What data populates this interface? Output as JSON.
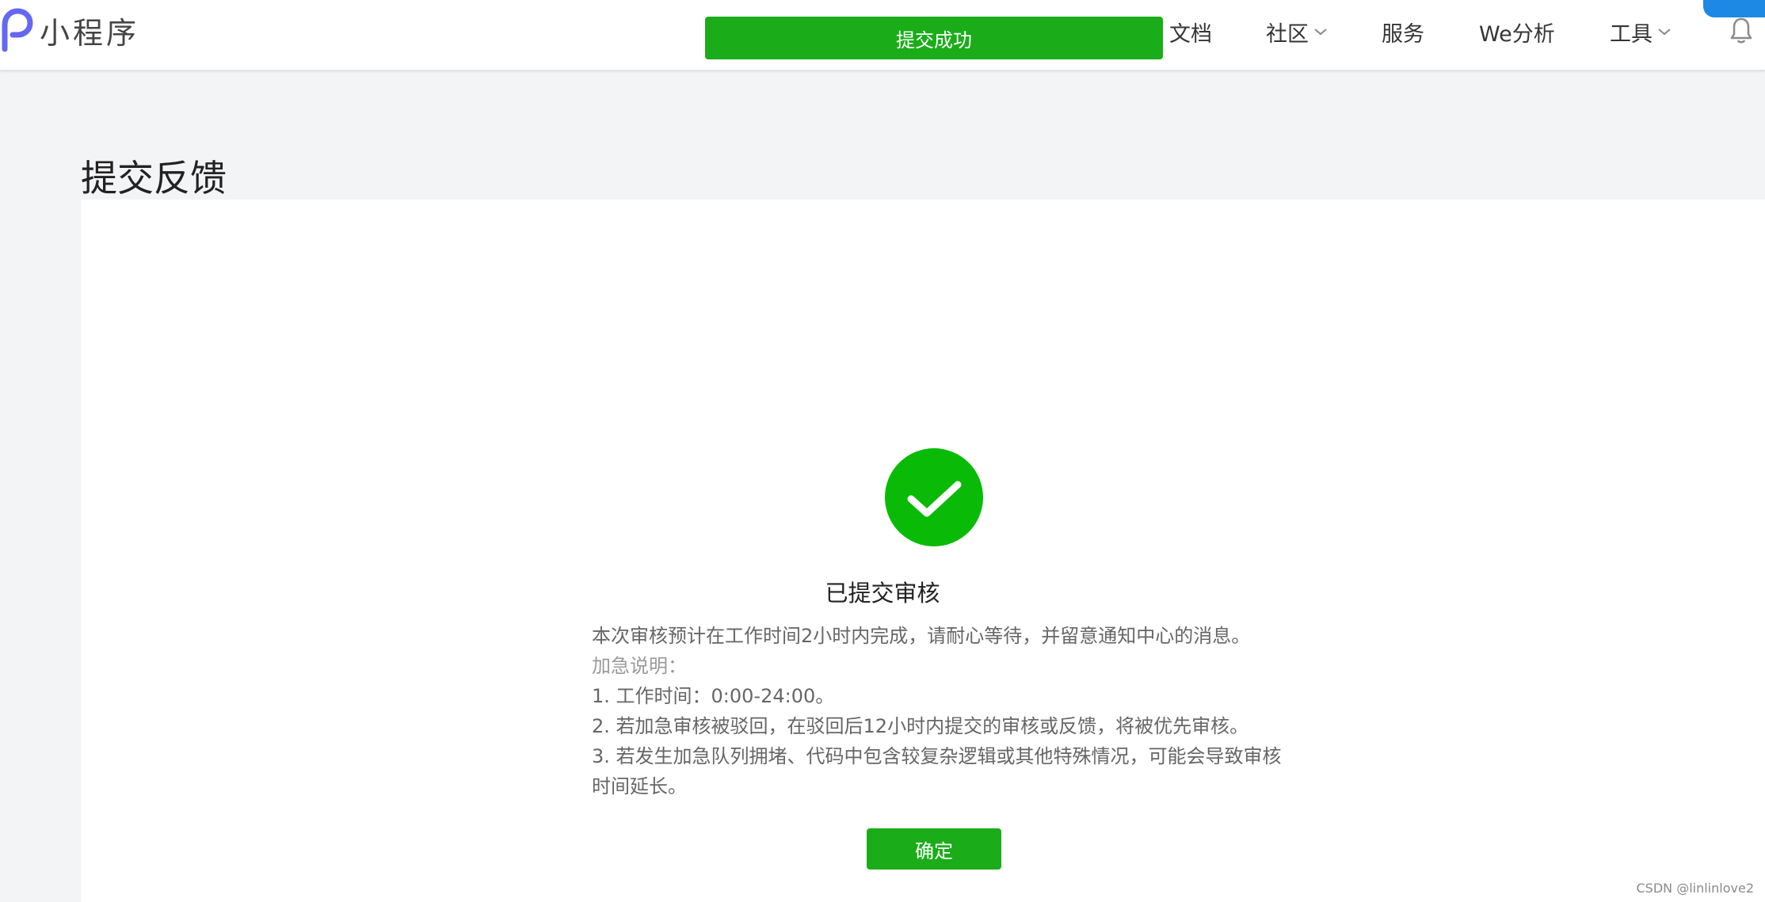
{
  "header": {
    "app_name": "小程序",
    "toast": "提交成功",
    "nav": {
      "docs": "文档",
      "community": "社区",
      "service": "服务",
      "we_analytics": "We分析",
      "tools": "工具"
    },
    "icons": [
      "logo-icon",
      "chevron-down-icon",
      "bell-icon"
    ]
  },
  "page": {
    "title": "提交反馈"
  },
  "result": {
    "icon": "check-circle-icon",
    "title": "已提交审核",
    "lines": [
      "本次审核预计在工作时间2小时内完成，请耐心等待，并留意通知中心的消息。",
      "加急说明：",
      "1. 工作时间：0:00-24:00。",
      "2. 若加急审核被驳回，在驳回后12小时内提交的审核或反馈，将被优先审核。",
      "3. 若发生加急队列拥堵、代码中包含较复杂逻辑或其他特殊情况，可能会导致审核时间延长。"
    ],
    "confirm_label": "确定"
  },
  "watermark": "CSDN @linlinlove2",
  "colors": {
    "brand_green": "#1aad19",
    "logo_purple": "#6467f0",
    "success_green": "#09bb07"
  }
}
